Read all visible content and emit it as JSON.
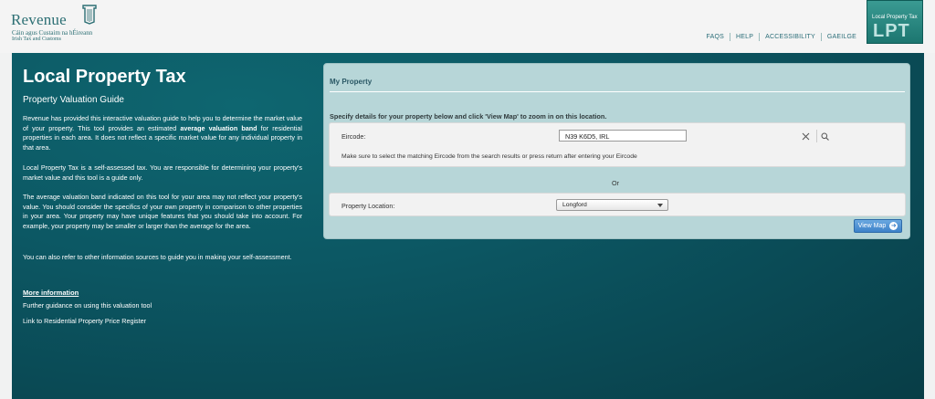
{
  "header": {
    "logo_title": "Revenue",
    "logo_sub_irish": "Cáin agus Custaim na hÉireann",
    "logo_sub_english": "Irish Tax and Customs",
    "links": [
      "FAQS",
      "HELP",
      "ACCESSIBILITY",
      "GAEILGE"
    ],
    "badge_small": "Local Property Tax",
    "badge_big": "LPT"
  },
  "left": {
    "title": "Local Property Tax",
    "subtitle": "Property Valuation Guide",
    "para1_a": "Revenue has provided this interactive valuation guide to help you to determine the market value of your property. This tool provides an estimated ",
    "para1_bold": "average valuation band",
    "para1_b": " for residential properties in each area. It does not reflect a specific market value for any individual property in that area.",
    "para2": "Local Property Tax is a self-assessed tax. You are responsible for determining your property's market value and this tool is a guide only.",
    "para3": "The average valuation band indicated on this tool for your area may not reflect your property's value. You should consider the specifics of your own property in comparison to other properties in your area. Your property may have unique features that you should take into account. For example, your property may be smaller or larger than the average for the area.",
    "para4": "You can also refer to other information sources to guide you in making your self-assessment.",
    "more_title": "More information",
    "more_links": [
      "Further guidance on using this valuation tool",
      "Link to Residential Property Price Register"
    ]
  },
  "card": {
    "title": "My Property",
    "instructions": "Specify details for your property below and click 'View Map' to zoom in on this location.",
    "eircode_label": "Eircode:",
    "eircode_value": "N39 K6D5, IRL",
    "eircode_hint": "Make sure to select the matching Eircode from the search results or press return after entering your Eircode",
    "or_text": "Or",
    "location_label": "Property Location:",
    "location_value": "Longford",
    "view_map": "View Map"
  },
  "colors": {
    "panel": "#0c5763",
    "card": "#b7d6d8",
    "button": "#4a8fd2",
    "brand": "#2c6f74"
  }
}
